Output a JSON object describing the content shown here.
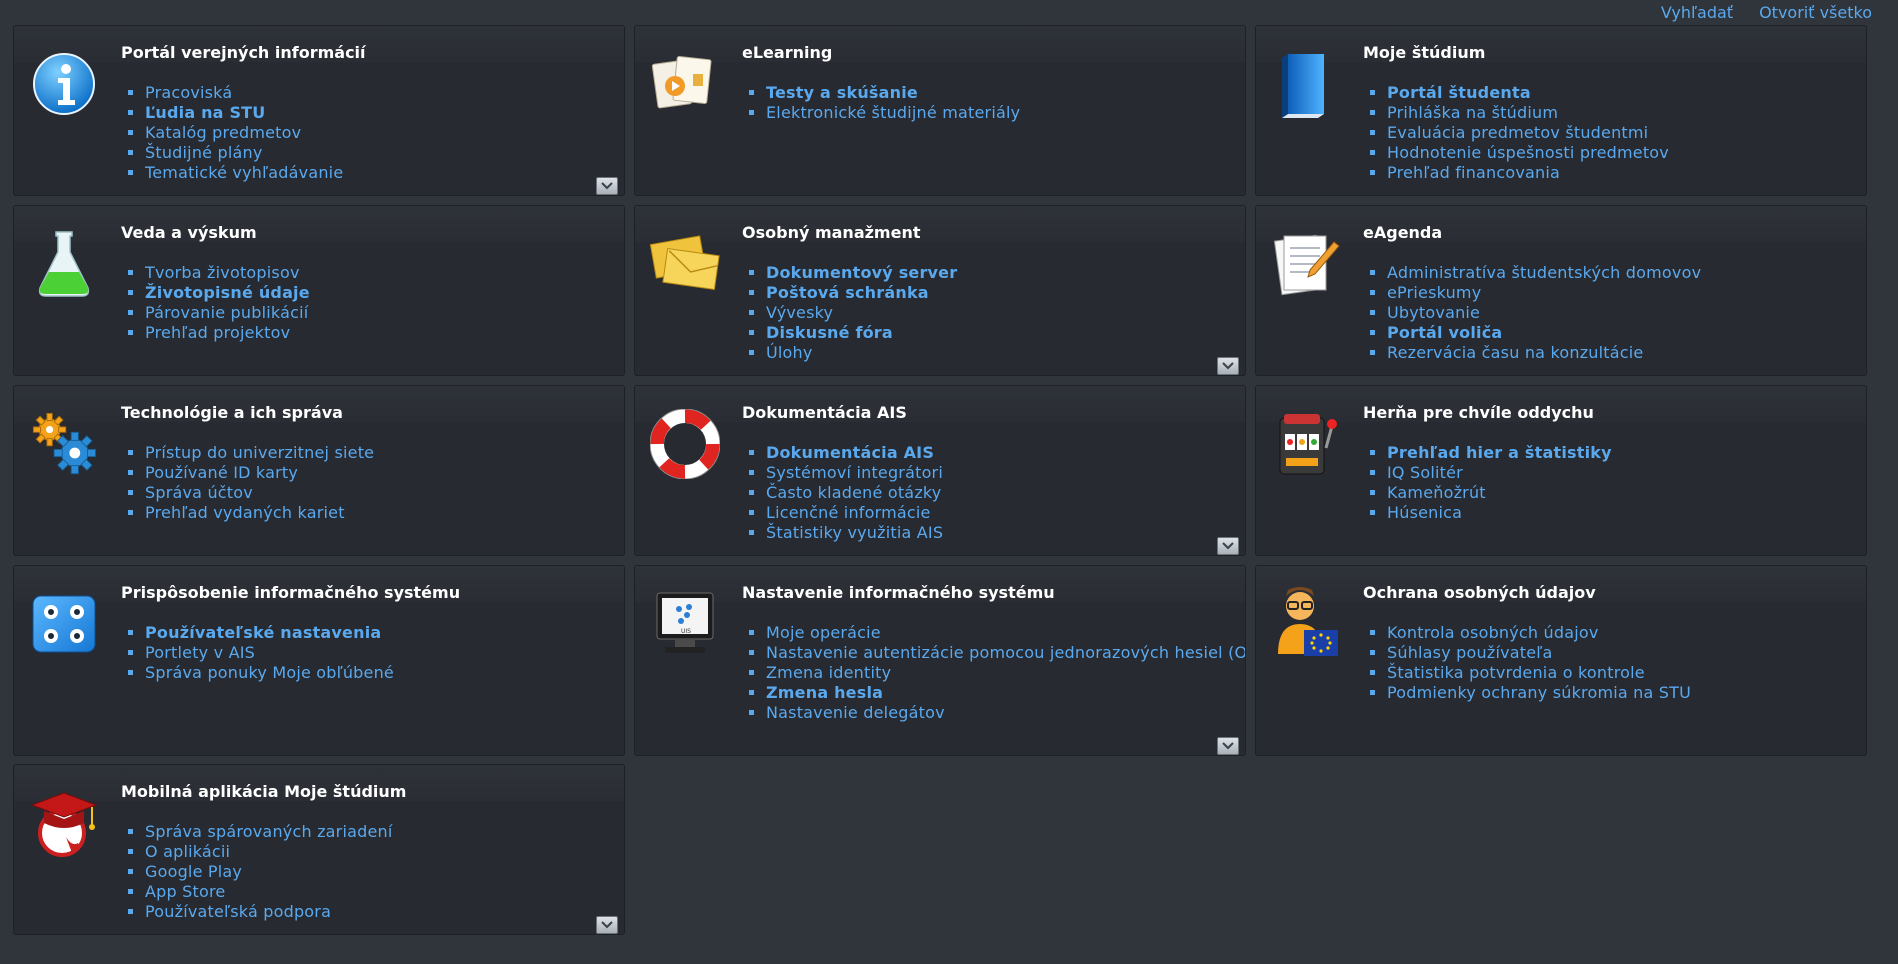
{
  "topbar": {
    "search": "Vyhľadať",
    "open_all": "Otvoriť všetko"
  },
  "panels": [
    {
      "title": "Portál verejných informácií",
      "icon": "info-icon",
      "items": [
        {
          "label": "Pracoviská",
          "bold": false
        },
        {
          "label": "Ľudia na STU",
          "bold": true
        },
        {
          "label": "Katalóg predmetov",
          "bold": false
        },
        {
          "label": "Študijné plány",
          "bold": false
        },
        {
          "label": "Tematické vyhľadávanie",
          "bold": false
        }
      ],
      "expandable": true
    },
    {
      "title": "eLearning",
      "icon": "elearning-icon",
      "items": [
        {
          "label": "Testy a skúšanie",
          "bold": true
        },
        {
          "label": "Elektronické študijné materiály",
          "bold": false
        }
      ],
      "expandable": false
    },
    {
      "title": "Moje štúdium",
      "icon": "book-icon",
      "items": [
        {
          "label": "Portál študenta",
          "bold": true
        },
        {
          "label": "Prihláška na štúdium",
          "bold": false
        },
        {
          "label": "Evaluácia predmetov študentmi",
          "bold": false
        },
        {
          "label": "Hodnotenie úspešnosti predmetov",
          "bold": false
        },
        {
          "label": "Prehľad financovania",
          "bold": false
        }
      ],
      "expandable": false
    },
    {
      "title": "Veda a výskum",
      "icon": "flask-icon",
      "items": [
        {
          "label": "Tvorba životopisov",
          "bold": false
        },
        {
          "label": "Životopisné údaje",
          "bold": true
        },
        {
          "label": "Párovanie publikácií",
          "bold": false
        },
        {
          "label": "Prehľad projektov",
          "bold": false
        }
      ],
      "expandable": false
    },
    {
      "title": "Osobný manažment",
      "icon": "envelopes-icon",
      "items": [
        {
          "label": "Dokumentový server",
          "bold": true
        },
        {
          "label": "Poštová schránka",
          "bold": true
        },
        {
          "label": "Vývesky",
          "bold": false
        },
        {
          "label": "Diskusné fóra",
          "bold": true
        },
        {
          "label": "Úlohy",
          "bold": false
        }
      ],
      "expandable": true
    },
    {
      "title": "eAgenda",
      "icon": "notepad-icon",
      "items": [
        {
          "label": "Administratíva študentských domovov",
          "bold": false
        },
        {
          "label": "ePrieskumy",
          "bold": false
        },
        {
          "label": "Ubytovanie",
          "bold": false
        },
        {
          "label": "Portál voliča",
          "bold": true
        },
        {
          "label": "Rezervácia času na konzultácie",
          "bold": false
        }
      ],
      "expandable": false
    },
    {
      "title": "Technológie a ich správa",
      "icon": "gears-icon",
      "items": [
        {
          "label": "Prístup do univerzitnej siete",
          "bold": false
        },
        {
          "label": "Používané ID karty",
          "bold": false
        },
        {
          "label": "Správa účtov",
          "bold": false
        },
        {
          "label": "Prehľad vydaných kariet",
          "bold": false
        }
      ],
      "expandable": false
    },
    {
      "title": "Dokumentácia AIS",
      "icon": "lifebuoy-icon",
      "items": [
        {
          "label": "Dokumentácia AIS",
          "bold": true
        },
        {
          "label": "Systémoví integrátori",
          "bold": false
        },
        {
          "label": "Často kladené otázky",
          "bold": false
        },
        {
          "label": "Licenčné informácie",
          "bold": false
        },
        {
          "label": "Štatistiky využitia AIS",
          "bold": false
        }
      ],
      "expandable": true
    },
    {
      "title": "Herňa pre chvíle oddychu",
      "icon": "slot-machine-icon",
      "items": [
        {
          "label": "Prehľad hier a štatistiky",
          "bold": true
        },
        {
          "label": "IQ Solitér",
          "bold": false
        },
        {
          "label": "Kameňožrút",
          "bold": false
        },
        {
          "label": "Húsenica",
          "bold": false
        }
      ],
      "expandable": false
    },
    {
      "title": "Prispôsobenie informačného systému",
      "icon": "dice-icon",
      "items": [
        {
          "label": "Používateľské nastavenia",
          "bold": true
        },
        {
          "label": "Portlety v AIS",
          "bold": false
        },
        {
          "label": "Správa ponuky Moje obľúbené",
          "bold": false
        }
      ],
      "expandable": false
    },
    {
      "title": "Nastavenie informačného systému",
      "icon": "monitor-icon",
      "items": [
        {
          "label": "Moje operácie",
          "bold": false
        },
        {
          "label": "Nastavenie autentizácie pomocou jednorazových hesiel (OTP)",
          "bold": false
        },
        {
          "label": "Zmena identity",
          "bold": false
        },
        {
          "label": "Zmena hesla",
          "bold": true
        },
        {
          "label": "Nastavenie delegátov",
          "bold": false
        }
      ],
      "expandable": true
    },
    {
      "title": "Ochrana osobných údajov",
      "icon": "privacy-person-icon",
      "items": [
        {
          "label": "Kontrola osobných údajov",
          "bold": false
        },
        {
          "label": "Súhlasy používateľa",
          "bold": false
        },
        {
          "label": "Štatistika potvrdenia o kontrole",
          "bold": false
        },
        {
          "label": "Podmienky ochrany súkromia na STU",
          "bold": false
        }
      ],
      "expandable": false
    },
    {
      "title": "Mobilná aplikácia Moje štúdium",
      "icon": "graduation-cap-icon",
      "items": [
        {
          "label": "Správa spárovaných zariadení",
          "bold": false
        },
        {
          "label": "O aplikácii",
          "bold": false
        },
        {
          "label": "Google Play",
          "bold": false
        },
        {
          "label": "App Store",
          "bold": false
        },
        {
          "label": "Používateľská podpora",
          "bold": false
        }
      ],
      "expandable": true
    }
  ]
}
